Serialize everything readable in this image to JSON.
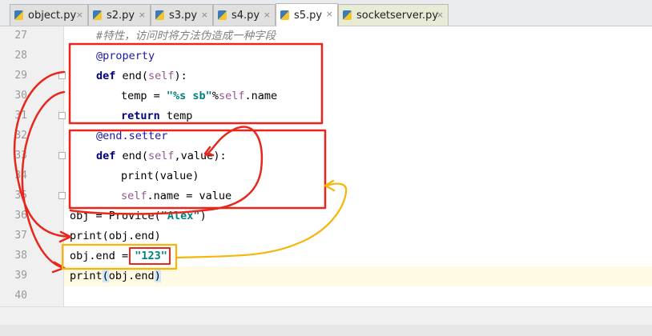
{
  "tabs": [
    {
      "label": "object.py",
      "close": "×"
    },
    {
      "label": "s2.py",
      "close": "×"
    },
    {
      "label": "s3.py",
      "close": "×"
    },
    {
      "label": "s4.py",
      "close": "×"
    },
    {
      "label": "s5.py",
      "close": "×",
      "active": true
    },
    {
      "label": "socketserver.py",
      "close": "×"
    }
  ],
  "line_numbers": [
    "27",
    "28",
    "29",
    "30",
    "31",
    "32",
    "33",
    "34",
    "35",
    "36",
    "37",
    "38",
    "39",
    "40"
  ],
  "code": {
    "l27": "#特性，访问时将方法伪造成一种字段",
    "l28_dec": "@property",
    "l29_kw": "def",
    "l29_a": " end(",
    "l29_self": "self",
    "l29_b": "):",
    "l30_a": "temp = ",
    "l30_str": "\"%s sb\"",
    "l30_b": "%",
    "l30_self": "self",
    "l30_c": ".name",
    "l31_kw": "return",
    "l31_a": " temp",
    "l32_dec": "@end.setter",
    "l33_kw": "def",
    "l33_a": " end(",
    "l33_self": "self",
    "l33_b": ",value):",
    "l34": "print(value)",
    "l35_self": "self",
    "l35_a": ".name = value",
    "l36_a": "obj = Provice(",
    "l36_str": "\"Alex\"",
    "l36_b": ")",
    "l37": "print(obj.end)",
    "l38_a": "obj.end = ",
    "l38_str": "\"123\"",
    "l39_a": "print",
    "l39_b": "(",
    "l39_c": "obj.end",
    "l39_d": ")"
  },
  "colors": {
    "annotation_red": "#e8261c",
    "annotation_orange": "#f5b50a",
    "keyword": "#000080",
    "string": "#008080",
    "self": "#94558d",
    "comment": "#808080"
  }
}
